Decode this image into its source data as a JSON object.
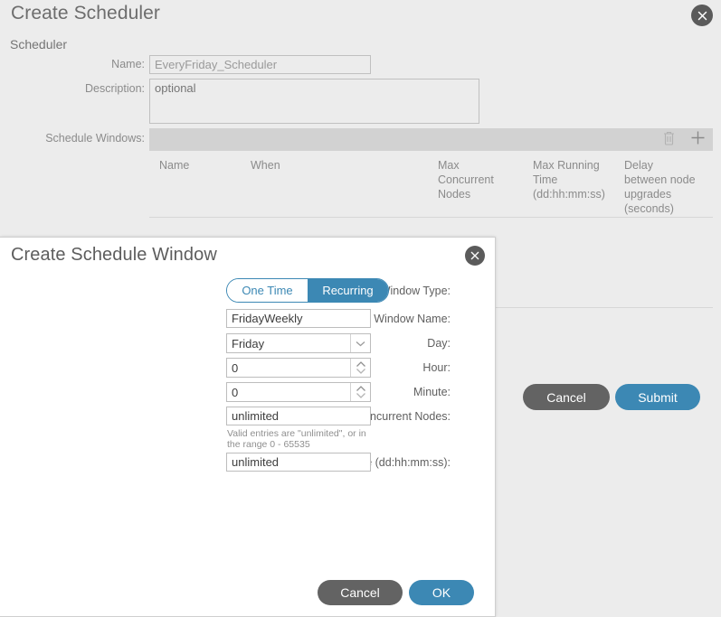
{
  "background_dialog": {
    "title": "Create Scheduler",
    "close_icon": "close-circle-icon",
    "section_label": "Scheduler",
    "fields": {
      "name_label": "Name:",
      "name_value": "EveryFriday_Scheduler",
      "description_label": "Description:",
      "description_value": "optional",
      "schedule_windows_label": "Schedule Windows:"
    },
    "toolbar": {
      "delete_icon": "trash-icon",
      "add_icon": "plus-icon"
    },
    "table": {
      "columns": [
        "Name",
        "When",
        "Max Concurrent Nodes",
        "Max Running Time (dd:hh:mm:ss)",
        "Delay between node upgrades (seconds)"
      ],
      "column_lines": [
        [
          "Name"
        ],
        [
          "When"
        ],
        [
          "Max",
          "Concurrent",
          "Nodes"
        ],
        [
          "Max Running",
          "Time",
          "(dd:hh:mm:ss)"
        ],
        [
          "Delay",
          "between node",
          "upgrades",
          "(seconds)"
        ]
      ],
      "rows": []
    },
    "buttons": {
      "cancel": "Cancel",
      "submit": "Submit"
    }
  },
  "modal": {
    "title": "Create Schedule Window",
    "close_icon": "close-circle-icon",
    "window_type": {
      "label": "Window Type:",
      "options": [
        "One Time",
        "Recurring"
      ],
      "selected": "Recurring"
    },
    "window_name": {
      "label": "Window Name:",
      "value": "FridayWeekly"
    },
    "day": {
      "label": "Day:",
      "value": "Friday",
      "dropdown_icon": "chevron-down-icon"
    },
    "hour": {
      "label": "Hour:",
      "value": "0",
      "spinner_icon": "spinner-up-down-icon"
    },
    "minute": {
      "label": "Minute:",
      "value": "0",
      "spinner_icon": "spinner-up-down-icon"
    },
    "max_concurrent_nodes": {
      "label": "Maximum Concurrent Nodes:",
      "value": "unlimited",
      "helper_text": "Valid entries are \"unlimited\", or in the range 0 - 65535"
    },
    "max_running_time": {
      "label": "Maximum Running Time (dd:hh:mm:ss):",
      "value": "unlimited"
    },
    "buttons": {
      "cancel": "Cancel",
      "ok": "OK"
    }
  },
  "colors": {
    "accent_blue": "#3c88b4",
    "cancel_gray": "#636363",
    "page_background": "#ececec",
    "toolbar_gray": "#d2d2d2",
    "modal_background": "#ffffff"
  }
}
